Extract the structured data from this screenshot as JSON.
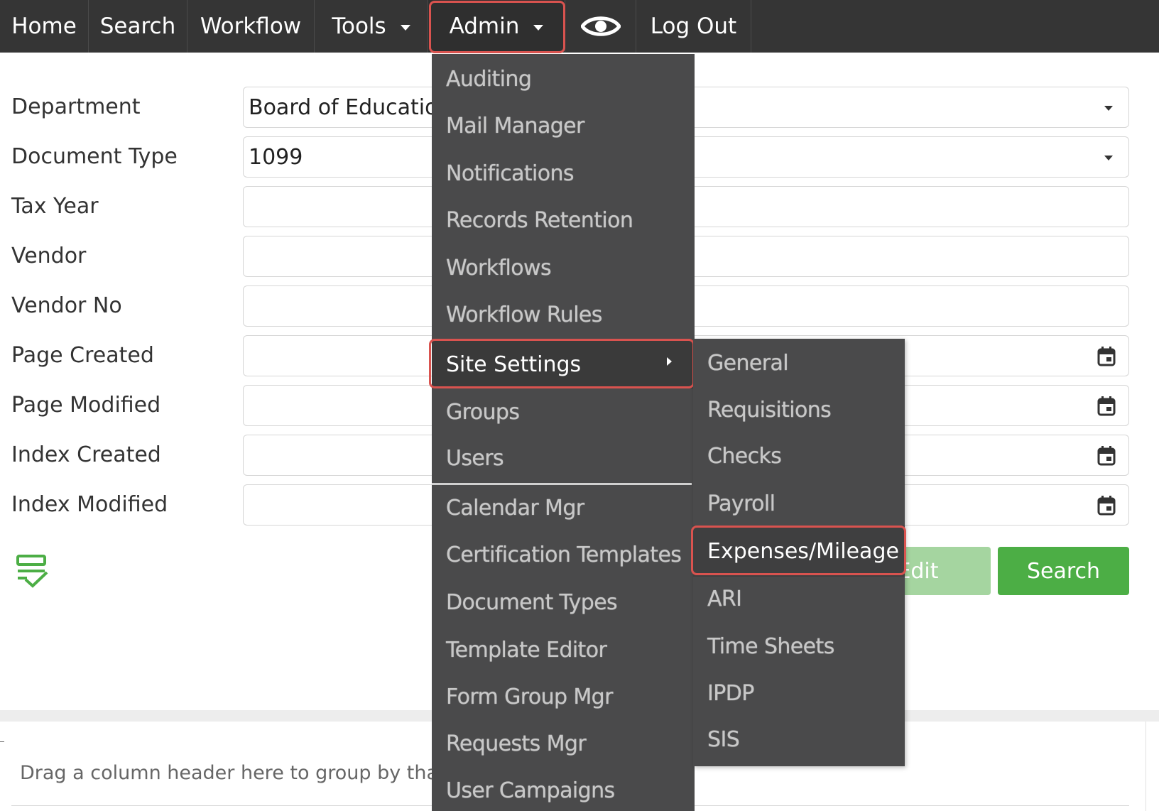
{
  "nav": {
    "items": [
      "Home",
      "Search",
      "Workflow",
      "Tools",
      "Admin"
    ],
    "eye_icon": "eye-icon",
    "logout": "Log Out",
    "bg_color": "#353535"
  },
  "form": {
    "department_label": "Department",
    "department_value": "Board of Educatio",
    "document_type_label": "Document Type",
    "document_type_value": "1099",
    "tax_year_label": "Tax Year",
    "vendor_label": "Vendor",
    "vendor_no_label": "Vendor No",
    "page_created_label": "Page Created",
    "page_modified_label": "Page Modified",
    "index_created_label": "Index Created",
    "index_modified_label": "Index Modified",
    "calendar_icon": "calendar-icon",
    "checklist_icon": "checklist-icon"
  },
  "buttons": {
    "edit": "Edit",
    "search": "Search",
    "search_color": "#4cae45",
    "edit_color": "#a5d5a0"
  },
  "grid": {
    "drag_hint": "Drag a column header here to group by that co"
  },
  "admin_menu": {
    "items": [
      "Auditing",
      "Mail Manager",
      "Notifications",
      "Records Retention",
      "Workflows",
      "Workflow Rules",
      "Site Settings",
      "Groups",
      "Users",
      "Calendar Mgr",
      "Certification Templates",
      "Document Types",
      "Template Editor",
      "Form Group Mgr",
      "Requests Mgr",
      "User Campaigns"
    ],
    "active": "Site Settings"
  },
  "site_settings_menu": {
    "items": [
      "General",
      "Requisitions",
      "Checks",
      "Payroll",
      "Expenses/Mileage",
      "ARI",
      "Time Sheets",
      "IPDP",
      "SIS"
    ],
    "active": "Expenses/Mileage"
  },
  "highlight_color": "#d9534f"
}
